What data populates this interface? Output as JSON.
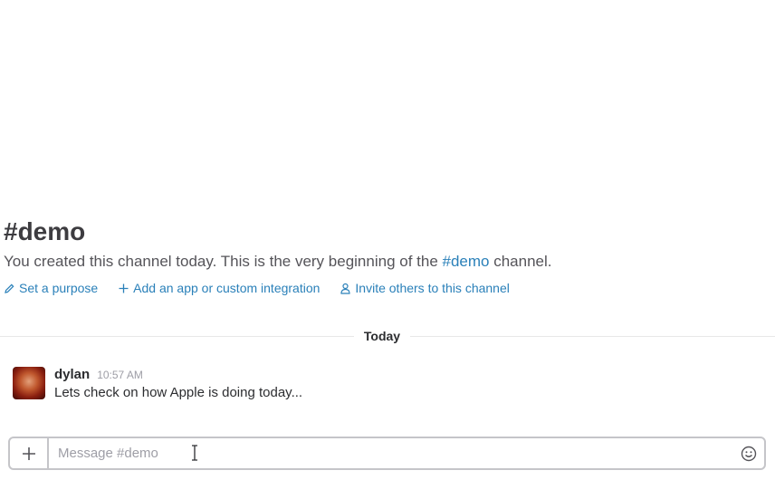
{
  "channel": {
    "title": "#demo",
    "description_prefix": "You created this channel today. This is the very beginning of the ",
    "description_link": "#demo",
    "description_suffix": " channel."
  },
  "actions": [
    {
      "label": "Set a purpose",
      "icon": "pencil-icon"
    },
    {
      "label": "Add an app or custom integration",
      "icon": "plus-icon"
    },
    {
      "label": "Invite others to this channel",
      "icon": "person-icon"
    }
  ],
  "divider": {
    "label": "Today"
  },
  "messages": [
    {
      "author": "dylan",
      "time": "10:57 AM",
      "text": "Lets check on how Apple is doing today..."
    }
  ],
  "composer": {
    "placeholder": "Message #demo"
  },
  "colors": {
    "link": "#2a80b9",
    "text": "#2c2d30",
    "muted": "#9e9ea6",
    "border": "#c5c5c9"
  }
}
